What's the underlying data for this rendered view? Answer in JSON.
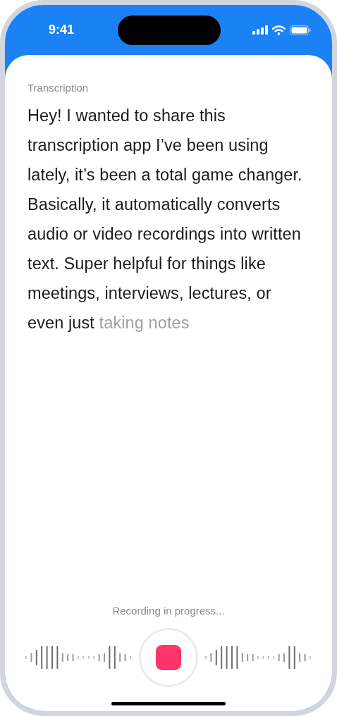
{
  "status_bar": {
    "time": "9:41"
  },
  "transcript": {
    "label": "Transcription",
    "final_text": "Hey! I wanted to share this transcription app I’ve been using lately, it’s been a total game changer. Basically, it automatically converts audio or video recordings into written text. Super helpful for things like meetings, interviews, lectures, or even just",
    "pending_text": "taking notes"
  },
  "recorder": {
    "status": "Recording in progress...",
    "recording": true
  }
}
